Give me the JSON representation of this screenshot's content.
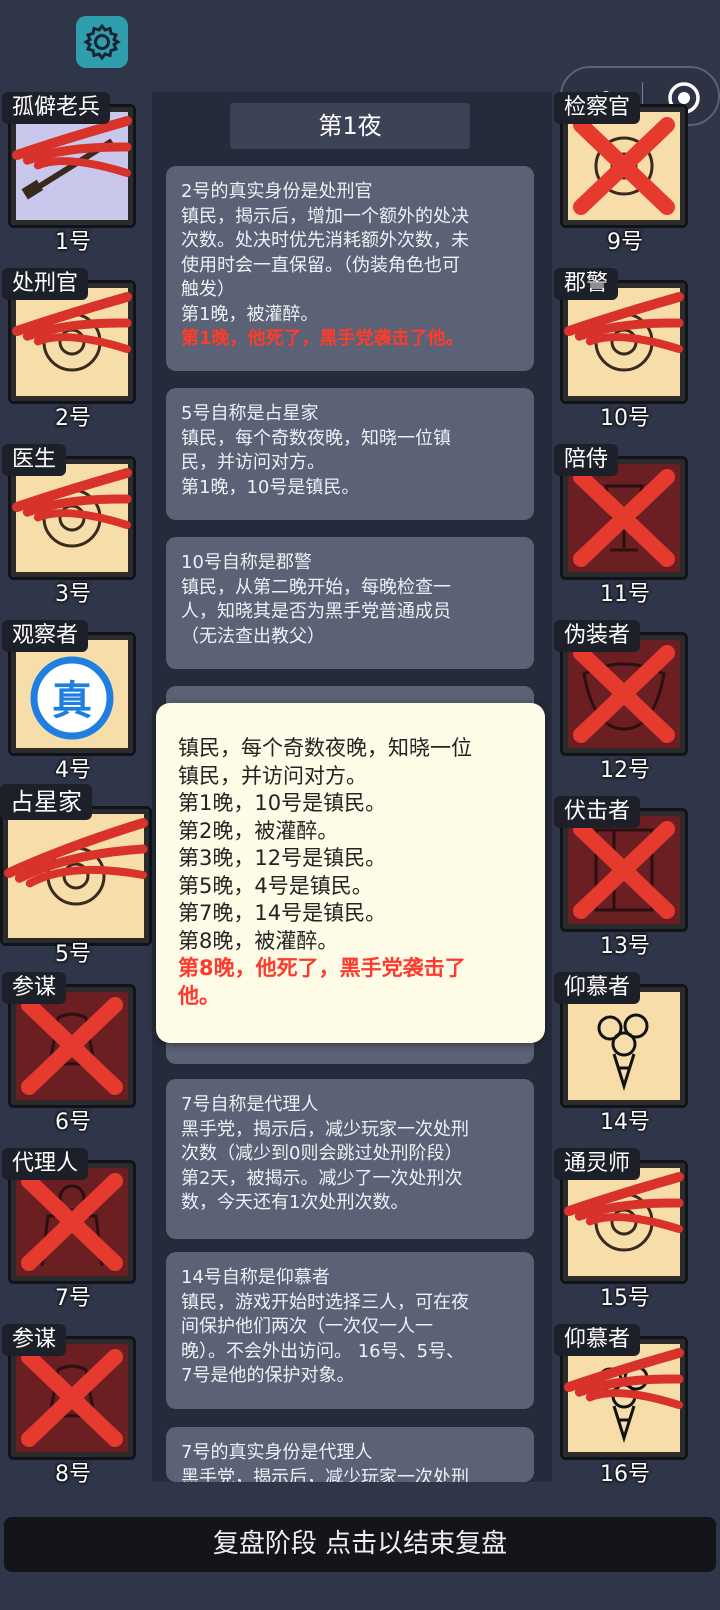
{
  "night_title": "第1夜",
  "left_players": [
    {
      "role": "孤僻老兵",
      "num": "1号",
      "bg": "lav",
      "mark": "claw",
      "icon": "rifle-icon"
    },
    {
      "role": "处刑官",
      "num": "2号",
      "bg": "cream",
      "mark": "claw",
      "icon": "executioner-icon"
    },
    {
      "role": "医生",
      "num": "3号",
      "bg": "cream",
      "mark": "claw",
      "icon": "syringe-icon"
    },
    {
      "role": "观察者",
      "num": "4号",
      "bg": "cream",
      "mark": "verified",
      "icon": "observer-icon"
    },
    {
      "role": "占星家",
      "num": "5号",
      "bg": "cream",
      "mark": "claw",
      "icon": "astrolabe-icon"
    },
    {
      "role": "参谋",
      "num": "6号",
      "bg": "dark",
      "mark": "x",
      "icon": "hat-icon"
    },
    {
      "role": "代理人",
      "num": "7号",
      "bg": "dark",
      "mark": "x",
      "icon": "agent-icon"
    },
    {
      "role": "参谋",
      "num": "8号",
      "bg": "dark",
      "mark": "x",
      "icon": "hat-icon"
    }
  ],
  "right_players": [
    {
      "role": "检察官",
      "num": "9号",
      "bg": "cream",
      "mark": "x",
      "icon": "badge-icon"
    },
    {
      "role": "郡警",
      "num": "10号",
      "bg": "cream",
      "mark": "claw",
      "icon": "sheriff-star-icon"
    },
    {
      "role": "陪侍",
      "num": "11号",
      "bg": "dark",
      "mark": "x",
      "icon": "glass-icon"
    },
    {
      "role": "伪装者",
      "num": "12号",
      "bg": "dark",
      "mark": "x",
      "icon": "mask-icon"
    },
    {
      "role": "伏击者",
      "num": "13号",
      "bg": "dark",
      "mark": "x",
      "icon": "door-icon"
    },
    {
      "role": "仰慕者",
      "num": "14号",
      "bg": "cream",
      "mark": "none",
      "icon": "flowers-icon"
    },
    {
      "role": "通灵师",
      "num": "15号",
      "bg": "cream",
      "mark": "claw",
      "icon": "crystal-ball-icon"
    },
    {
      "role": "仰慕者",
      "num": "16号",
      "bg": "cream",
      "mark": "claw",
      "icon": "flowers-icon"
    }
  ],
  "verified_label": "真",
  "logs": [
    {
      "lines": [
        "2号的真实身份是处刑官",
        "镇民，揭示后，增加一个额外的处决",
        "次数。处决时优先消耗额外次数，未",
        "使用时会一直保留。（伪装角色也可",
        "触发）",
        "第1晚，被灌醉。"
      ],
      "red": "第1晚，他死了，黑手党袭击了他。"
    },
    {
      "lines": [
        "5号自称是占星家",
        "镇民，每个奇数夜晚，知晓一位镇",
        "民，并访问对方。",
        "第1晚，10号是镇民。"
      ],
      "red": ""
    },
    {
      "lines": [
        "10号自称是郡警",
        "镇民，从第二晚开始，每晚检查一",
        "人，知晓其是否为黑手党普通成员",
        "（无法查出教父）"
      ],
      "red": ""
    },
    {
      "lines": [
        "7号自称是代理人",
        "黑手党，揭示后，减少玩家一次处刑",
        "次数（减少到0则会跳过处刑阶段）",
        "第2天，被揭示。减少了一次处刑次",
        "数，今天还有1次处刑次数。"
      ],
      "red": ""
    },
    {
      "lines": [
        "14号自称是仰慕者",
        "镇民，游戏开始时选择三人，可在夜",
        "间保护他们两次（一次仅一人一",
        "晚）。不会外出访问。 16号、5号、",
        "7号是他的保护对象。"
      ],
      "red": ""
    },
    {
      "lines": [
        "7号的真实身份是代理人",
        "黑手党，揭示后，减少玩家一次处刑"
      ],
      "red": ""
    }
  ],
  "popup": {
    "lines": [
      "镇民，每个奇数夜晚，知晓一位",
      "镇民，并访问对方。",
      "第1晚，10号是镇民。",
      "第2晚，被灌醉。",
      "第3晚，12号是镇民。",
      "第5晚，4号是镇民。",
      "第7晚，14号是镇民。",
      "第8晚，被灌醉。"
    ],
    "red": [
      "第8晚，他死了，黑手党袭击了",
      "他。"
    ]
  },
  "bottom_button": "复盘阶段 点击以结束复盘",
  "colors": {
    "claw": "#d8322b",
    "x": "#e63a2e",
    "verified": "#1e7fe0",
    "panel": "#262b3b",
    "card_log": "#5b6275"
  }
}
